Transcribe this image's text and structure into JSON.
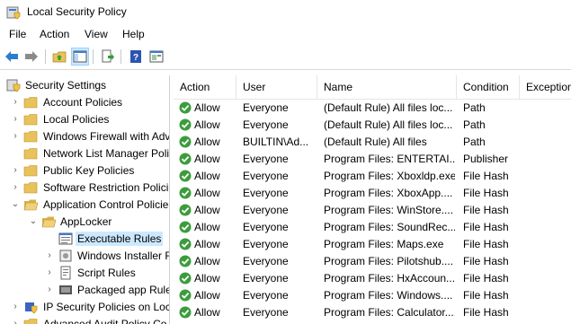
{
  "window": {
    "title": "Local Security Policy"
  },
  "menu": [
    "File",
    "Action",
    "View",
    "Help"
  ],
  "toolbar": {
    "buttons": [
      "back-icon",
      "forward-icon",
      "up-folder-icon",
      "show-hide-tree-icon",
      "export-list-icon",
      "help-icon",
      "properties-icon"
    ]
  },
  "tree": {
    "root": "Security Settings",
    "items": [
      {
        "label": "Account Policies",
        "expanded": false
      },
      {
        "label": "Local Policies",
        "expanded": false
      },
      {
        "label": "Windows Firewall with Adv",
        "expanded": false
      },
      {
        "label": "Network List Manager Poli",
        "expanded": false
      },
      {
        "label": "Public Key Policies",
        "expanded": false
      },
      {
        "label": "Software Restriction Polici",
        "expanded": false
      },
      {
        "label": "Application Control Policie",
        "expanded": true
      }
    ],
    "applocker": "AppLocker",
    "applocker_children": [
      {
        "label": "Executable Rules",
        "selected": true
      },
      {
        "label": "Windows Installer R",
        "selected": false
      },
      {
        "label": "Script Rules",
        "selected": false
      },
      {
        "label": "Packaged app Rule",
        "selected": false
      }
    ],
    "after": [
      {
        "label": "IP Security Policies on Loc"
      },
      {
        "label": "Advanced Audit Policy Co"
      }
    ]
  },
  "list": {
    "columns": [
      "Action",
      "User",
      "Name",
      "Condition",
      "Exception"
    ],
    "rows": [
      {
        "action": "Allow",
        "user": "Everyone",
        "name": "(Default Rule) All files loc...",
        "condition": "Path"
      },
      {
        "action": "Allow",
        "user": "Everyone",
        "name": "(Default Rule) All files loc...",
        "condition": "Path"
      },
      {
        "action": "Allow",
        "user": "BUILTIN\\Ad...",
        "name": "(Default Rule) All files",
        "condition": "Path"
      },
      {
        "action": "Allow",
        "user": "Everyone",
        "name": "Program Files: ENTERTAI...",
        "condition": "Publisher"
      },
      {
        "action": "Allow",
        "user": "Everyone",
        "name": "Program Files: Xboxldp.exe",
        "condition": "File Hash"
      },
      {
        "action": "Allow",
        "user": "Everyone",
        "name": "Program Files: XboxApp....",
        "condition": "File Hash"
      },
      {
        "action": "Allow",
        "user": "Everyone",
        "name": "Program Files: WinStore....",
        "condition": "File Hash"
      },
      {
        "action": "Allow",
        "user": "Everyone",
        "name": "Program Files: SoundRec....",
        "condition": "File Hash"
      },
      {
        "action": "Allow",
        "user": "Everyone",
        "name": "Program Files: Maps.exe",
        "condition": "File Hash"
      },
      {
        "action": "Allow",
        "user": "Everyone",
        "name": "Program Files: Pilotshub....",
        "condition": "File Hash"
      },
      {
        "action": "Allow",
        "user": "Everyone",
        "name": "Program Files: HxAccoun....",
        "condition": "File Hash"
      },
      {
        "action": "Allow",
        "user": "Everyone",
        "name": "Program Files: Windows....",
        "condition": "File Hash"
      },
      {
        "action": "Allow",
        "user": "Everyone",
        "name": "Program Files: Calculator....",
        "condition": "File Hash"
      }
    ]
  },
  "colors": {
    "selected": "#cce8ff",
    "allow_green": "#3c9c3c",
    "folder": "#e8c25a"
  }
}
